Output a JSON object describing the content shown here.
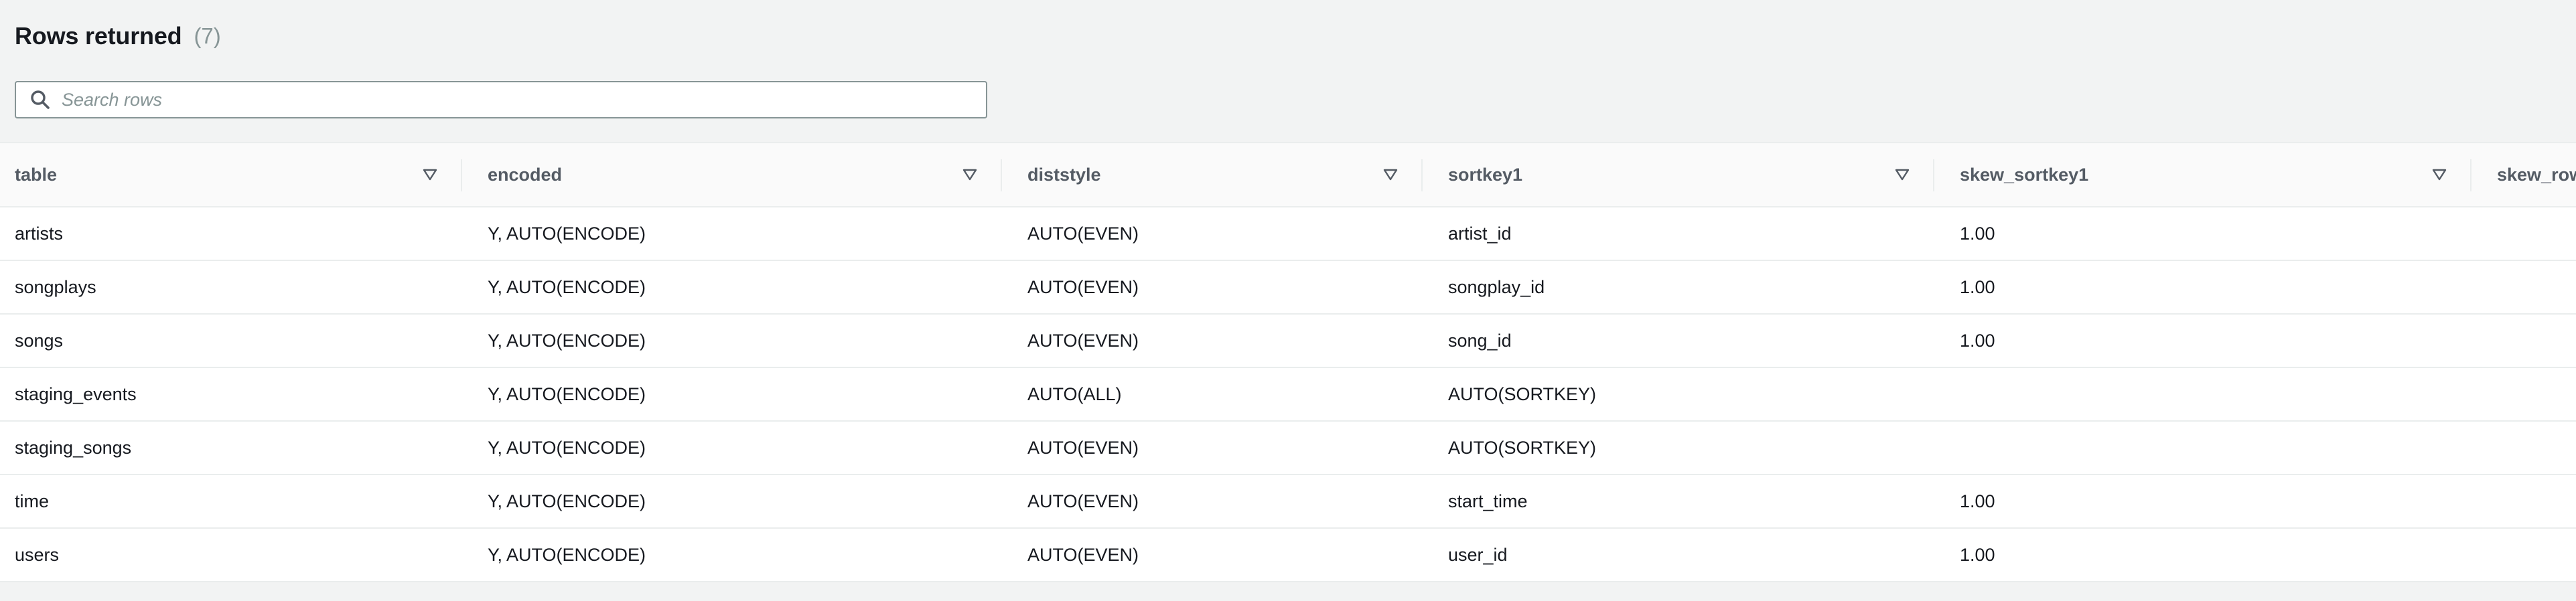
{
  "header": {
    "title": "Rows returned",
    "count": "(7)"
  },
  "search": {
    "placeholder": "Search rows",
    "value": ""
  },
  "icons": {
    "search": "search-icon",
    "sort": "sort-down-triangle-icon"
  },
  "colors": {
    "page_background": "#f2f3f3",
    "table_background": "#ffffff",
    "header_text": "#545b64",
    "muted_text": "#879596",
    "border": "#eaeded"
  },
  "table": {
    "columns": [
      "table",
      "encoded",
      "diststyle",
      "sortkey1",
      "skew_sortkey1",
      "skew_rows"
    ],
    "rows": [
      [
        "artists",
        "Y, AUTO(ENCODE)",
        "AUTO(EVEN)",
        "artist_id",
        "1.00",
        ""
      ],
      [
        "songplays",
        "Y, AUTO(ENCODE)",
        "AUTO(EVEN)",
        "songplay_id",
        "1.00",
        ""
      ],
      [
        "songs",
        "Y, AUTO(ENCODE)",
        "AUTO(EVEN)",
        "song_id",
        "1.00",
        ""
      ],
      [
        "staging_events",
        "Y, AUTO(ENCODE)",
        "AUTO(ALL)",
        "AUTO(SORTKEY)",
        "",
        ""
      ],
      [
        "staging_songs",
        "Y, AUTO(ENCODE)",
        "AUTO(EVEN)",
        "AUTO(SORTKEY)",
        "",
        ""
      ],
      [
        "time",
        "Y, AUTO(ENCODE)",
        "AUTO(EVEN)",
        "start_time",
        "1.00",
        ""
      ],
      [
        "users",
        "Y, AUTO(ENCODE)",
        "AUTO(EVEN)",
        "user_id",
        "1.00",
        ""
      ]
    ]
  }
}
